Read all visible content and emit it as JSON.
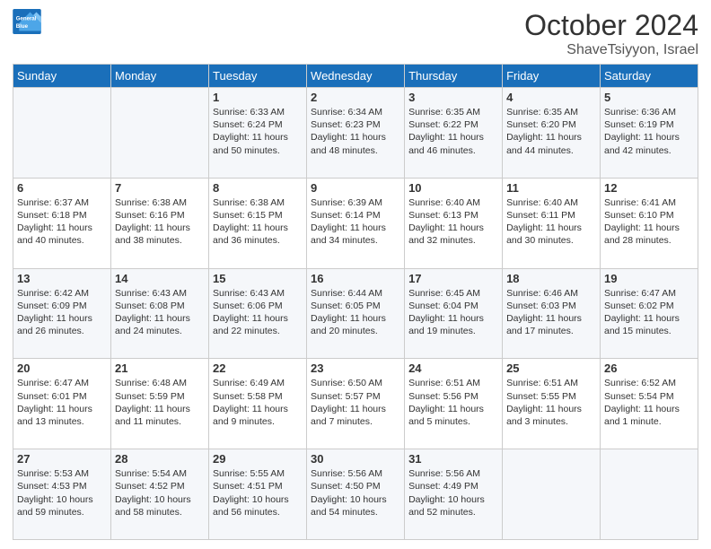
{
  "logo": {
    "text_general": "General",
    "text_blue": "Blue"
  },
  "header": {
    "month": "October 2024",
    "location": "ShaveTsiyyon, Israel"
  },
  "weekdays": [
    "Sunday",
    "Monday",
    "Tuesday",
    "Wednesday",
    "Thursday",
    "Friday",
    "Saturday"
  ],
  "weeks": [
    [
      {
        "day": "",
        "sunrise": "",
        "sunset": "",
        "daylight": ""
      },
      {
        "day": "",
        "sunrise": "",
        "sunset": "",
        "daylight": ""
      },
      {
        "day": "1",
        "sunrise": "Sunrise: 6:33 AM",
        "sunset": "Sunset: 6:24 PM",
        "daylight": "Daylight: 11 hours and 50 minutes."
      },
      {
        "day": "2",
        "sunrise": "Sunrise: 6:34 AM",
        "sunset": "Sunset: 6:23 PM",
        "daylight": "Daylight: 11 hours and 48 minutes."
      },
      {
        "day": "3",
        "sunrise": "Sunrise: 6:35 AM",
        "sunset": "Sunset: 6:22 PM",
        "daylight": "Daylight: 11 hours and 46 minutes."
      },
      {
        "day": "4",
        "sunrise": "Sunrise: 6:35 AM",
        "sunset": "Sunset: 6:20 PM",
        "daylight": "Daylight: 11 hours and 44 minutes."
      },
      {
        "day": "5",
        "sunrise": "Sunrise: 6:36 AM",
        "sunset": "Sunset: 6:19 PM",
        "daylight": "Daylight: 11 hours and 42 minutes."
      }
    ],
    [
      {
        "day": "6",
        "sunrise": "Sunrise: 6:37 AM",
        "sunset": "Sunset: 6:18 PM",
        "daylight": "Daylight: 11 hours and 40 minutes."
      },
      {
        "day": "7",
        "sunrise": "Sunrise: 6:38 AM",
        "sunset": "Sunset: 6:16 PM",
        "daylight": "Daylight: 11 hours and 38 minutes."
      },
      {
        "day": "8",
        "sunrise": "Sunrise: 6:38 AM",
        "sunset": "Sunset: 6:15 PM",
        "daylight": "Daylight: 11 hours and 36 minutes."
      },
      {
        "day": "9",
        "sunrise": "Sunrise: 6:39 AM",
        "sunset": "Sunset: 6:14 PM",
        "daylight": "Daylight: 11 hours and 34 minutes."
      },
      {
        "day": "10",
        "sunrise": "Sunrise: 6:40 AM",
        "sunset": "Sunset: 6:13 PM",
        "daylight": "Daylight: 11 hours and 32 minutes."
      },
      {
        "day": "11",
        "sunrise": "Sunrise: 6:40 AM",
        "sunset": "Sunset: 6:11 PM",
        "daylight": "Daylight: 11 hours and 30 minutes."
      },
      {
        "day": "12",
        "sunrise": "Sunrise: 6:41 AM",
        "sunset": "Sunset: 6:10 PM",
        "daylight": "Daylight: 11 hours and 28 minutes."
      }
    ],
    [
      {
        "day": "13",
        "sunrise": "Sunrise: 6:42 AM",
        "sunset": "Sunset: 6:09 PM",
        "daylight": "Daylight: 11 hours and 26 minutes."
      },
      {
        "day": "14",
        "sunrise": "Sunrise: 6:43 AM",
        "sunset": "Sunset: 6:08 PM",
        "daylight": "Daylight: 11 hours and 24 minutes."
      },
      {
        "day": "15",
        "sunrise": "Sunrise: 6:43 AM",
        "sunset": "Sunset: 6:06 PM",
        "daylight": "Daylight: 11 hours and 22 minutes."
      },
      {
        "day": "16",
        "sunrise": "Sunrise: 6:44 AM",
        "sunset": "Sunset: 6:05 PM",
        "daylight": "Daylight: 11 hours and 20 minutes."
      },
      {
        "day": "17",
        "sunrise": "Sunrise: 6:45 AM",
        "sunset": "Sunset: 6:04 PM",
        "daylight": "Daylight: 11 hours and 19 minutes."
      },
      {
        "day": "18",
        "sunrise": "Sunrise: 6:46 AM",
        "sunset": "Sunset: 6:03 PM",
        "daylight": "Daylight: 11 hours and 17 minutes."
      },
      {
        "day": "19",
        "sunrise": "Sunrise: 6:47 AM",
        "sunset": "Sunset: 6:02 PM",
        "daylight": "Daylight: 11 hours and 15 minutes."
      }
    ],
    [
      {
        "day": "20",
        "sunrise": "Sunrise: 6:47 AM",
        "sunset": "Sunset: 6:01 PM",
        "daylight": "Daylight: 11 hours and 13 minutes."
      },
      {
        "day": "21",
        "sunrise": "Sunrise: 6:48 AM",
        "sunset": "Sunset: 5:59 PM",
        "daylight": "Daylight: 11 hours and 11 minutes."
      },
      {
        "day": "22",
        "sunrise": "Sunrise: 6:49 AM",
        "sunset": "Sunset: 5:58 PM",
        "daylight": "Daylight: 11 hours and 9 minutes."
      },
      {
        "day": "23",
        "sunrise": "Sunrise: 6:50 AM",
        "sunset": "Sunset: 5:57 PM",
        "daylight": "Daylight: 11 hours and 7 minutes."
      },
      {
        "day": "24",
        "sunrise": "Sunrise: 6:51 AM",
        "sunset": "Sunset: 5:56 PM",
        "daylight": "Daylight: 11 hours and 5 minutes."
      },
      {
        "day": "25",
        "sunrise": "Sunrise: 6:51 AM",
        "sunset": "Sunset: 5:55 PM",
        "daylight": "Daylight: 11 hours and 3 minutes."
      },
      {
        "day": "26",
        "sunrise": "Sunrise: 6:52 AM",
        "sunset": "Sunset: 5:54 PM",
        "daylight": "Daylight: 11 hours and 1 minute."
      }
    ],
    [
      {
        "day": "27",
        "sunrise": "Sunrise: 5:53 AM",
        "sunset": "Sunset: 4:53 PM",
        "daylight": "Daylight: 10 hours and 59 minutes."
      },
      {
        "day": "28",
        "sunrise": "Sunrise: 5:54 AM",
        "sunset": "Sunset: 4:52 PM",
        "daylight": "Daylight: 10 hours and 58 minutes."
      },
      {
        "day": "29",
        "sunrise": "Sunrise: 5:55 AM",
        "sunset": "Sunset: 4:51 PM",
        "daylight": "Daylight: 10 hours and 56 minutes."
      },
      {
        "day": "30",
        "sunrise": "Sunrise: 5:56 AM",
        "sunset": "Sunset: 4:50 PM",
        "daylight": "Daylight: 10 hours and 54 minutes."
      },
      {
        "day": "31",
        "sunrise": "Sunrise: 5:56 AM",
        "sunset": "Sunset: 4:49 PM",
        "daylight": "Daylight: 10 hours and 52 minutes."
      },
      {
        "day": "",
        "sunrise": "",
        "sunset": "",
        "daylight": ""
      },
      {
        "day": "",
        "sunrise": "",
        "sunset": "",
        "daylight": ""
      }
    ]
  ]
}
